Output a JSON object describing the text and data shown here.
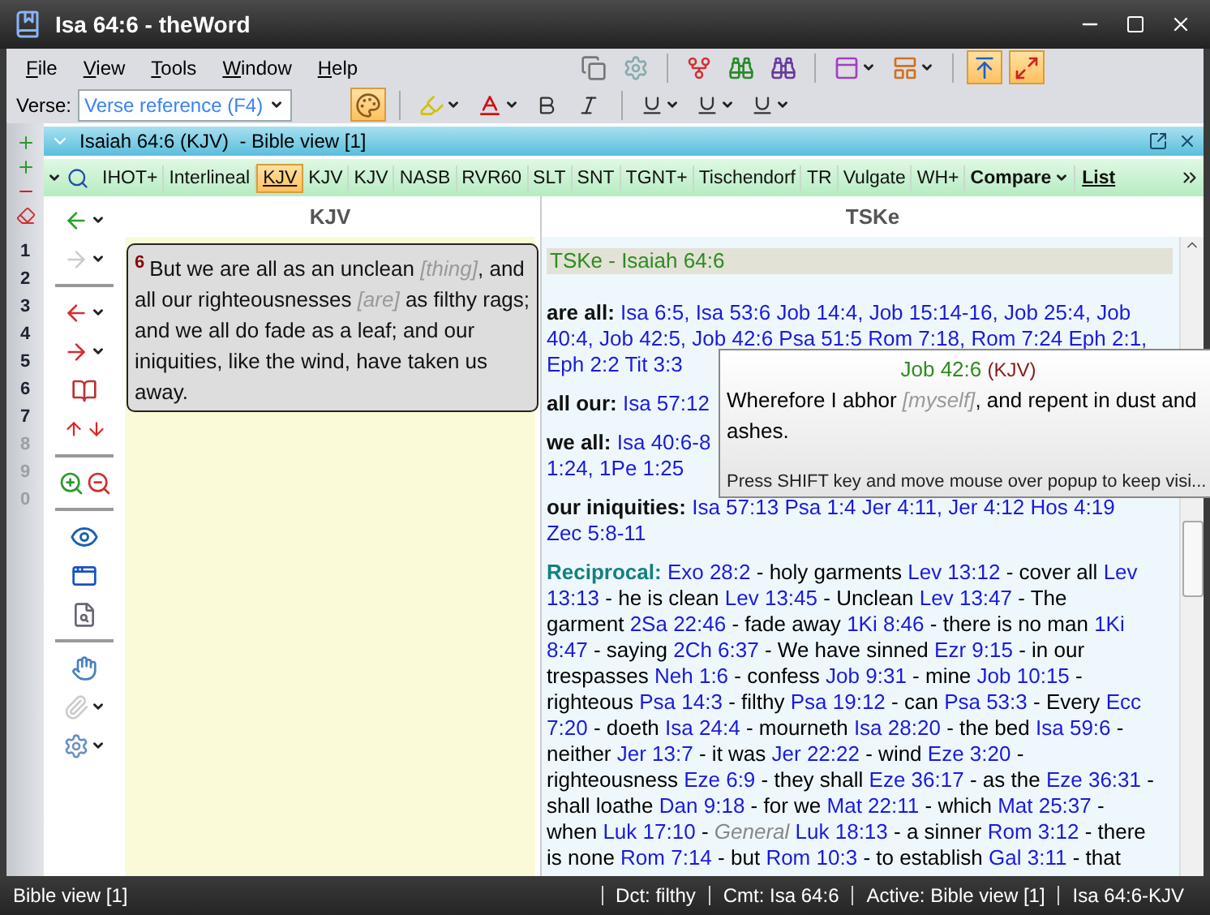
{
  "window": {
    "title": "Isa 64:6 - theWord"
  },
  "menu": [
    "File",
    "View",
    "Tools",
    "Window",
    "Help"
  ],
  "verse_field": {
    "label": "Verse:",
    "placeholder": "Verse reference (F4)"
  },
  "number_strip": [
    {
      "label": "1",
      "disabled": false
    },
    {
      "label": "2",
      "disabled": false
    },
    {
      "label": "3",
      "disabled": false
    },
    {
      "label": "4",
      "disabled": false
    },
    {
      "label": "5",
      "disabled": false
    },
    {
      "label": "6",
      "disabled": false
    },
    {
      "label": "7",
      "disabled": false
    },
    {
      "label": "8",
      "disabled": true
    },
    {
      "label": "9",
      "disabled": true
    },
    {
      "label": "0",
      "disabled": true
    }
  ],
  "bible_view": {
    "title": "Isaiah 64:6 (KJV)  - Bible view [1]",
    "tabs": [
      {
        "label": "IHOT+",
        "kind": "version",
        "selected": false
      },
      {
        "label": "Interlineal",
        "kind": "version",
        "selected": false
      },
      {
        "label": "KJV",
        "kind": "version",
        "selected": true
      },
      {
        "label": "KJV",
        "kind": "version",
        "selected": false
      },
      {
        "label": "KJV",
        "kind": "version",
        "selected": false
      },
      {
        "label": "NASB",
        "kind": "version",
        "selected": false
      },
      {
        "label": "RVR60",
        "kind": "version",
        "selected": false
      },
      {
        "label": "SLT",
        "kind": "version",
        "selected": false
      },
      {
        "label": "SNT",
        "kind": "version",
        "selected": false
      },
      {
        "label": "TGNT+",
        "kind": "version",
        "selected": false
      },
      {
        "label": "Tischendorf",
        "kind": "version",
        "selected": false
      },
      {
        "label": "TR",
        "kind": "version",
        "selected": false
      },
      {
        "label": "Vulgate",
        "kind": "version",
        "selected": false
      },
      {
        "label": "WH+",
        "kind": "version",
        "selected": false
      },
      {
        "label": "Compare",
        "kind": "menu",
        "selected": false
      },
      {
        "label": "List",
        "kind": "link",
        "selected": false
      }
    ]
  },
  "kjv_pane": {
    "heading": "KJV",
    "verse": {
      "number": "6",
      "segments": [
        {
          "kind": "text",
          "text": "But we are all as an unclean "
        },
        {
          "kind": "added",
          "text": "[thing]"
        },
        {
          "kind": "text",
          "text": ", and all our righteousnesses "
        },
        {
          "kind": "added",
          "text": "[are]"
        },
        {
          "kind": "text",
          "text": " as filthy rags; and we all do fade as a leaf; and our iniquities, like the wind, have taken us away."
        }
      ]
    }
  },
  "tske_pane": {
    "heading": "TSKe",
    "title": "TSKe - Isaiah 64:6",
    "entries": [
      {
        "lines": [
          [
            {
              "kind": "term",
              "text": "are all:"
            },
            {
              "kind": "ref",
              "text": "Isa 6:5,"
            },
            {
              "kind": "ref",
              "text": "Isa 53:6"
            },
            {
              "kind": "ref",
              "text": "Job 14:4,"
            },
            {
              "kind": "ref",
              "text": "Job 15:14-16,"
            },
            {
              "kind": "ref",
              "text": "Job 25:4,"
            },
            {
              "kind": "ref",
              "text": "Job"
            }
          ],
          [
            {
              "kind": "ref",
              "text": "40:4,"
            },
            {
              "kind": "ref",
              "text": "Job 42:5,"
            },
            {
              "kind": "ref",
              "text": "Job 42:6"
            },
            {
              "kind": "ref",
              "text": "Psa 51:5"
            },
            {
              "kind": "ref",
              "text": "Rom 7:18,"
            },
            {
              "kind": "ref",
              "text": "Rom 7:24"
            },
            {
              "kind": "ref",
              "text": "Eph 2:1,"
            }
          ],
          [
            {
              "kind": "ref",
              "text": "Eph 2:2"
            },
            {
              "kind": "ref",
              "text": "Tit 3:3"
            }
          ]
        ]
      },
      {
        "lines": [
          [
            {
              "kind": "term",
              "text": "all our:"
            },
            {
              "kind": "ref",
              "text": "Isa 57:12"
            }
          ]
        ]
      },
      {
        "lines": [
          [
            {
              "kind": "term",
              "text": "we all:"
            },
            {
              "kind": "ref",
              "text": "Isa 40:6-8"
            }
          ],
          [
            {
              "kind": "ref",
              "text": "1:24,"
            },
            {
              "kind": "ref",
              "text": "1Pe 1:25"
            }
          ]
        ]
      },
      {
        "lines": [
          [
            {
              "kind": "term",
              "text": "our iniquities:"
            },
            {
              "kind": "ref",
              "text": "Isa 57:13"
            },
            {
              "kind": "ref",
              "text": "Psa 1:4"
            },
            {
              "kind": "ref",
              "text": "Jer 4:11,"
            },
            {
              "kind": "ref",
              "text": "Jer 4:12"
            },
            {
              "kind": "ref",
              "text": "Hos 4:19"
            }
          ],
          [
            {
              "kind": "ref",
              "text": "Zec 5:8-11"
            }
          ]
        ]
      },
      {
        "lines": [
          [
            {
              "kind": "section",
              "text": "Reciprocal:"
            },
            {
              "kind": "ref",
              "text": "Exo 28:2"
            },
            {
              "kind": "text",
              "text": "- holy garments"
            },
            {
              "kind": "ref",
              "text": "Lev 13:12"
            },
            {
              "kind": "text",
              "text": "- cover all"
            },
            {
              "kind": "ref",
              "text": "Lev"
            }
          ],
          [
            {
              "kind": "ref",
              "text": "13:13"
            },
            {
              "kind": "text",
              "text": "- he is clean"
            },
            {
              "kind": "ref",
              "text": "Lev 13:45"
            },
            {
              "kind": "text",
              "text": "- Unclean"
            },
            {
              "kind": "ref",
              "text": "Lev 13:47"
            },
            {
              "kind": "text",
              "text": "- The"
            }
          ],
          [
            {
              "kind": "text",
              "text": "garment"
            },
            {
              "kind": "ref",
              "text": "2Sa 22:46"
            },
            {
              "kind": "text",
              "text": "- fade away"
            },
            {
              "kind": "ref",
              "text": "1Ki 8:46"
            },
            {
              "kind": "text",
              "text": "- there is no man"
            },
            {
              "kind": "ref",
              "text": "1Ki"
            }
          ],
          [
            {
              "kind": "ref",
              "text": "8:47"
            },
            {
              "kind": "text",
              "text": "- saying"
            },
            {
              "kind": "ref",
              "text": "2Ch 6:37"
            },
            {
              "kind": "text",
              "text": "- We have sinned"
            },
            {
              "kind": "ref",
              "text": "Ezr 9:15"
            },
            {
              "kind": "text",
              "text": "- in our"
            }
          ],
          [
            {
              "kind": "text",
              "text": "trespasses"
            },
            {
              "kind": "ref",
              "text": "Neh 1:6"
            },
            {
              "kind": "text",
              "text": "- confess"
            },
            {
              "kind": "ref",
              "text": "Job 9:31"
            },
            {
              "kind": "text",
              "text": "- mine"
            },
            {
              "kind": "ref",
              "text": "Job 10:15"
            },
            {
              "kind": "text",
              "text": "-"
            }
          ],
          [
            {
              "kind": "text",
              "text": "righteous"
            },
            {
              "kind": "ref",
              "text": "Psa 14:3"
            },
            {
              "kind": "text",
              "text": "- filthy"
            },
            {
              "kind": "ref",
              "text": "Psa 19:12"
            },
            {
              "kind": "text",
              "text": "- can"
            },
            {
              "kind": "ref",
              "text": "Psa 53:3"
            },
            {
              "kind": "text",
              "text": "- Every"
            },
            {
              "kind": "ref",
              "text": "Ecc"
            }
          ],
          [
            {
              "kind": "ref",
              "text": "7:20"
            },
            {
              "kind": "text",
              "text": "- doeth"
            },
            {
              "kind": "ref",
              "text": "Isa 24:4"
            },
            {
              "kind": "text",
              "text": "- mourneth"
            },
            {
              "kind": "ref",
              "text": "Isa 28:20"
            },
            {
              "kind": "text",
              "text": "- the bed"
            },
            {
              "kind": "ref",
              "text": "Isa 59:6"
            },
            {
              "kind": "text",
              "text": "-"
            }
          ],
          [
            {
              "kind": "text",
              "text": "neither"
            },
            {
              "kind": "ref",
              "text": "Jer 13:7"
            },
            {
              "kind": "text",
              "text": "- it was"
            },
            {
              "kind": "ref",
              "text": "Jer 22:22"
            },
            {
              "kind": "text",
              "text": "- wind"
            },
            {
              "kind": "ref",
              "text": "Eze 3:20"
            },
            {
              "kind": "text",
              "text": "-"
            }
          ],
          [
            {
              "kind": "text",
              "text": "righteousness"
            },
            {
              "kind": "ref",
              "text": "Eze 6:9"
            },
            {
              "kind": "text",
              "text": "- they shall"
            },
            {
              "kind": "ref",
              "text": "Eze 36:17"
            },
            {
              "kind": "text",
              "text": "- as the"
            },
            {
              "kind": "ref",
              "text": "Eze 36:31"
            },
            {
              "kind": "text",
              "text": "-"
            }
          ],
          [
            {
              "kind": "text",
              "text": "shall loathe"
            },
            {
              "kind": "ref",
              "text": "Dan 9:18"
            },
            {
              "kind": "text",
              "text": "- for we"
            },
            {
              "kind": "ref",
              "text": "Mat 22:11"
            },
            {
              "kind": "text",
              "text": "- which"
            },
            {
              "kind": "ref",
              "text": "Mat 25:37"
            },
            {
              "kind": "text",
              "text": "-"
            }
          ],
          [
            {
              "kind": "text",
              "text": "when"
            },
            {
              "kind": "ref",
              "text": "Luk 17:10"
            },
            {
              "kind": "text",
              "text": "-"
            },
            {
              "kind": "note",
              "text": "General"
            },
            {
              "kind": "ref",
              "text": "Luk 18:13"
            },
            {
              "kind": "text",
              "text": "- a sinner"
            },
            {
              "kind": "ref",
              "text": "Rom 3:12"
            },
            {
              "kind": "text",
              "text": "- there"
            }
          ],
          [
            {
              "kind": "text",
              "text": "is none"
            },
            {
              "kind": "ref",
              "text": "Rom 7:14"
            },
            {
              "kind": "text",
              "text": "- but"
            },
            {
              "kind": "ref",
              "text": "Rom 10:3"
            },
            {
              "kind": "text",
              "text": "- to establish"
            },
            {
              "kind": "ref",
              "text": "Gal 3:11"
            },
            {
              "kind": "text",
              "text": "- that"
            }
          ]
        ]
      }
    ]
  },
  "popup": {
    "reference": "Job 42:6",
    "version": "(KJV)",
    "segments": [
      {
        "kind": "text",
        "text": "Wherefore I abhor "
      },
      {
        "kind": "added",
        "text": "[myself]"
      },
      {
        "kind": "text",
        "text": ", and repent in dust and ashes."
      }
    ],
    "hint": "Press SHIFT key and move mouse over popup to keep visi..."
  },
  "status_bar": {
    "left": "Bible view [1]",
    "items": [
      "Dct: filthy",
      "Cmt: Isa 64:6",
      "Active: Bible view [1]",
      "Isa 64:6-KJV"
    ]
  }
}
